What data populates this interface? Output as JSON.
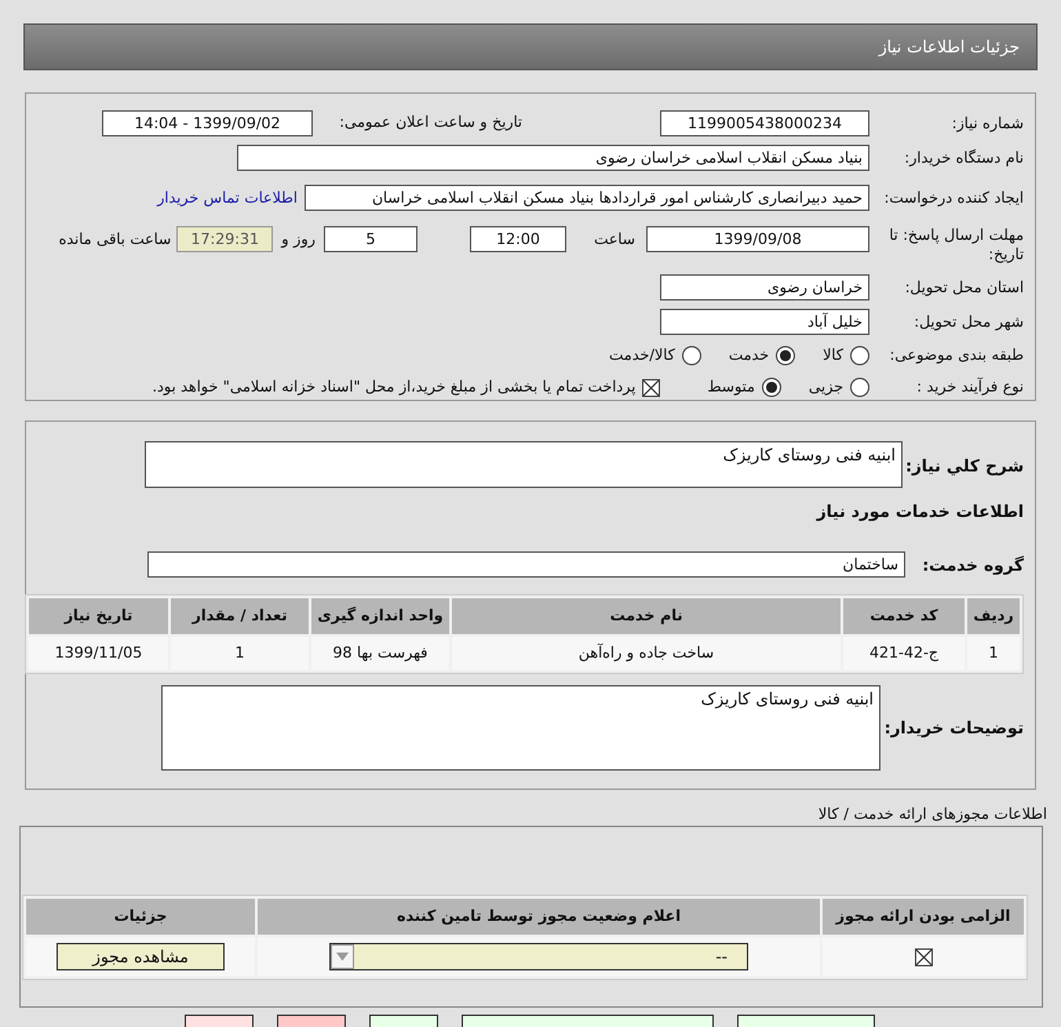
{
  "header": {
    "title": "جزئیات اطلاعات نیاز"
  },
  "details": {
    "need_number": {
      "label": "شماره نیاز:",
      "value": "1199005438000234"
    },
    "announce_date": {
      "label": "تاریخ و ساعت اعلان عمومی:",
      "value": "1399/09/02 - 14:04"
    },
    "buyer": {
      "label": "نام دستگاه خریدار:",
      "value": "بنیاد مسکن انقلاب اسلامی خراسان رضوی"
    },
    "creator": {
      "label": "ایجاد کننده درخواست:",
      "value": "حمید دبیرانصاری کارشناس امور قراردادها بنیاد مسکن انقلاب اسلامی خراسان",
      "link": "اطلاعات تماس خریدار"
    },
    "deadline": {
      "label": "مهلت ارسال پاسخ: تا تاریخ:",
      "date": "1399/09/08",
      "time_label": "ساعت",
      "time": "12:00",
      "days": "5",
      "days_label": "روز و",
      "remaining": "17:29:31",
      "remaining_label": "ساعت باقی مانده"
    },
    "province": {
      "label": "استان محل تحویل:",
      "value": "خراسان رضوی"
    },
    "city": {
      "label": "شهر محل تحویل:",
      "value": "خلیل آباد"
    },
    "category": {
      "label": "طبقه بندی موضوعی:",
      "options": [
        {
          "label": "کالا",
          "selected": false
        },
        {
          "label": "خدمت",
          "selected": true
        },
        {
          "label": "کالا/خدمت",
          "selected": false
        }
      ]
    },
    "process": {
      "label": "نوع فرآیند خرید :",
      "options": [
        {
          "label": "جزیی",
          "selected": false
        },
        {
          "label": "متوسط",
          "selected": true
        }
      ],
      "treasury": {
        "checked": true,
        "label": "پرداخت تمام یا بخشی از مبلغ خرید،از محل \"اسناد خزانه اسلامی\" خواهد بود."
      }
    }
  },
  "need": {
    "description_label": "شرح کلي نیاز:",
    "description": "ابنیه فنی روستای کاریزک",
    "services_heading": "اطلاعات خدمات مورد نیاز",
    "group_label": "گروه خدمت:",
    "group": "ساختمان",
    "table": {
      "columns": [
        "ردیف",
        "کد خدمت",
        "نام خدمت",
        "واحد اندازه گیری",
        "تعداد / مقدار",
        "تاریخ نیاز"
      ],
      "rows": [
        [
          "1",
          "ج-42-421",
          "ساخت جاده و راه‌آهن",
          "فهرست بها 98",
          "1",
          "1399/11/05"
        ]
      ]
    },
    "buyer_notes_label": "توضیحات خریدار:",
    "buyer_notes": "ابنیه فنی روستای کاریزک"
  },
  "licenses": {
    "title": "اطلاعات مجوزهای ارائه خدمت / کالا",
    "columns": [
      "الزامی بودن ارائه مجوز",
      "اعلام وضعیت مجوز توسط تامین کننده",
      "جزئیات"
    ],
    "rows": [
      {
        "required": true,
        "status": "--",
        "button": "مشاهده مجوز"
      }
    ]
  },
  "footer_buttons": [
    {
      "color": "#ffe0e0"
    },
    {
      "color": "#ffc8c8"
    },
    {
      "color": "#e8ffe8"
    },
    {
      "color": "#e8ffe8"
    },
    {
      "color": "#e8ffe8"
    }
  ]
}
